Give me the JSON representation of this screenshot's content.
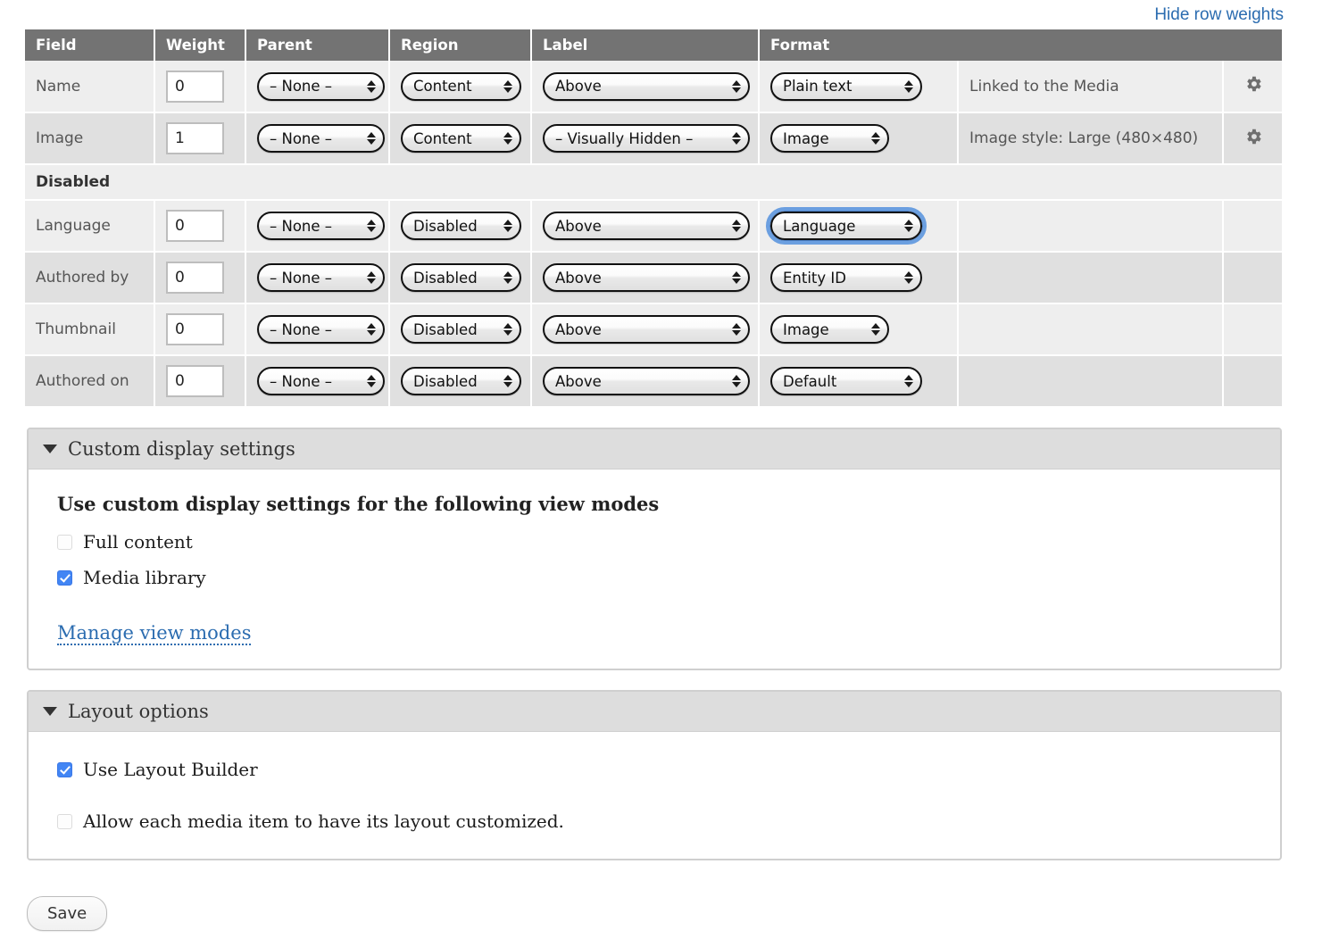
{
  "top": {
    "hide_row_weights_label": "Hide row weights"
  },
  "table": {
    "columns": [
      "Field",
      "Weight",
      "Parent",
      "Region",
      "Label",
      "Format",
      "",
      ""
    ],
    "rows": [
      {
        "type": "field",
        "field": "Name",
        "weight": "0",
        "parent": "– None –",
        "region": "Content",
        "label": "Above",
        "format": "Plain text",
        "summary": "Linked to the Media",
        "gear": "gear-icon",
        "format_focused": false
      },
      {
        "type": "field",
        "field": "Image",
        "weight": "1",
        "parent": "– None –",
        "region": "Content",
        "label": "– Visually Hidden –",
        "format": "Image",
        "summary": "Image style: Large (480×480)",
        "gear": "gear-icon",
        "format_focused": false
      },
      {
        "type": "region",
        "field": "Disabled"
      },
      {
        "type": "field",
        "field": "Language",
        "weight": "0",
        "parent": "– None –",
        "region": "Disabled",
        "label": "Above",
        "format": "Language",
        "summary": "",
        "gear": "",
        "format_focused": true
      },
      {
        "type": "field",
        "field": "Authored by",
        "weight": "0",
        "parent": "– None –",
        "region": "Disabled",
        "label": "Above",
        "format": "Entity ID",
        "summary": "",
        "gear": "",
        "format_focused": false
      },
      {
        "type": "field",
        "field": "Thumbnail",
        "weight": "0",
        "parent": "– None –",
        "region": "Disabled",
        "label": "Above",
        "format": "Image",
        "summary": "",
        "gear": "",
        "format_focused": false
      },
      {
        "type": "field",
        "field": "Authored on",
        "weight": "0",
        "parent": "– None –",
        "region": "Disabled",
        "label": "Above",
        "format": "Default",
        "summary": "",
        "gear": "",
        "format_focused": false
      }
    ]
  },
  "custom_display_settings": {
    "summary": "Custom display settings",
    "legend": "Use custom display settings for the following view modes",
    "options": [
      {
        "label": "Full content",
        "checked": false
      },
      {
        "label": "Media library",
        "checked": true
      }
    ],
    "manage_link": "Manage view modes"
  },
  "layout_options": {
    "summary": "Layout options",
    "options": [
      {
        "label": "Use Layout Builder",
        "checked": true
      },
      {
        "label": "Allow each media item to have its layout customized.",
        "checked": false
      }
    ]
  },
  "actions": {
    "save_label": "Save"
  },
  "colors": {
    "header_bg": "#737373",
    "link_blue": "#2b6cb0",
    "checkbox_blue": "#4285f4",
    "focus_ring": "#6b9fe0",
    "row_odd": "#eeeeee",
    "row_even": "#e0e0e0"
  }
}
